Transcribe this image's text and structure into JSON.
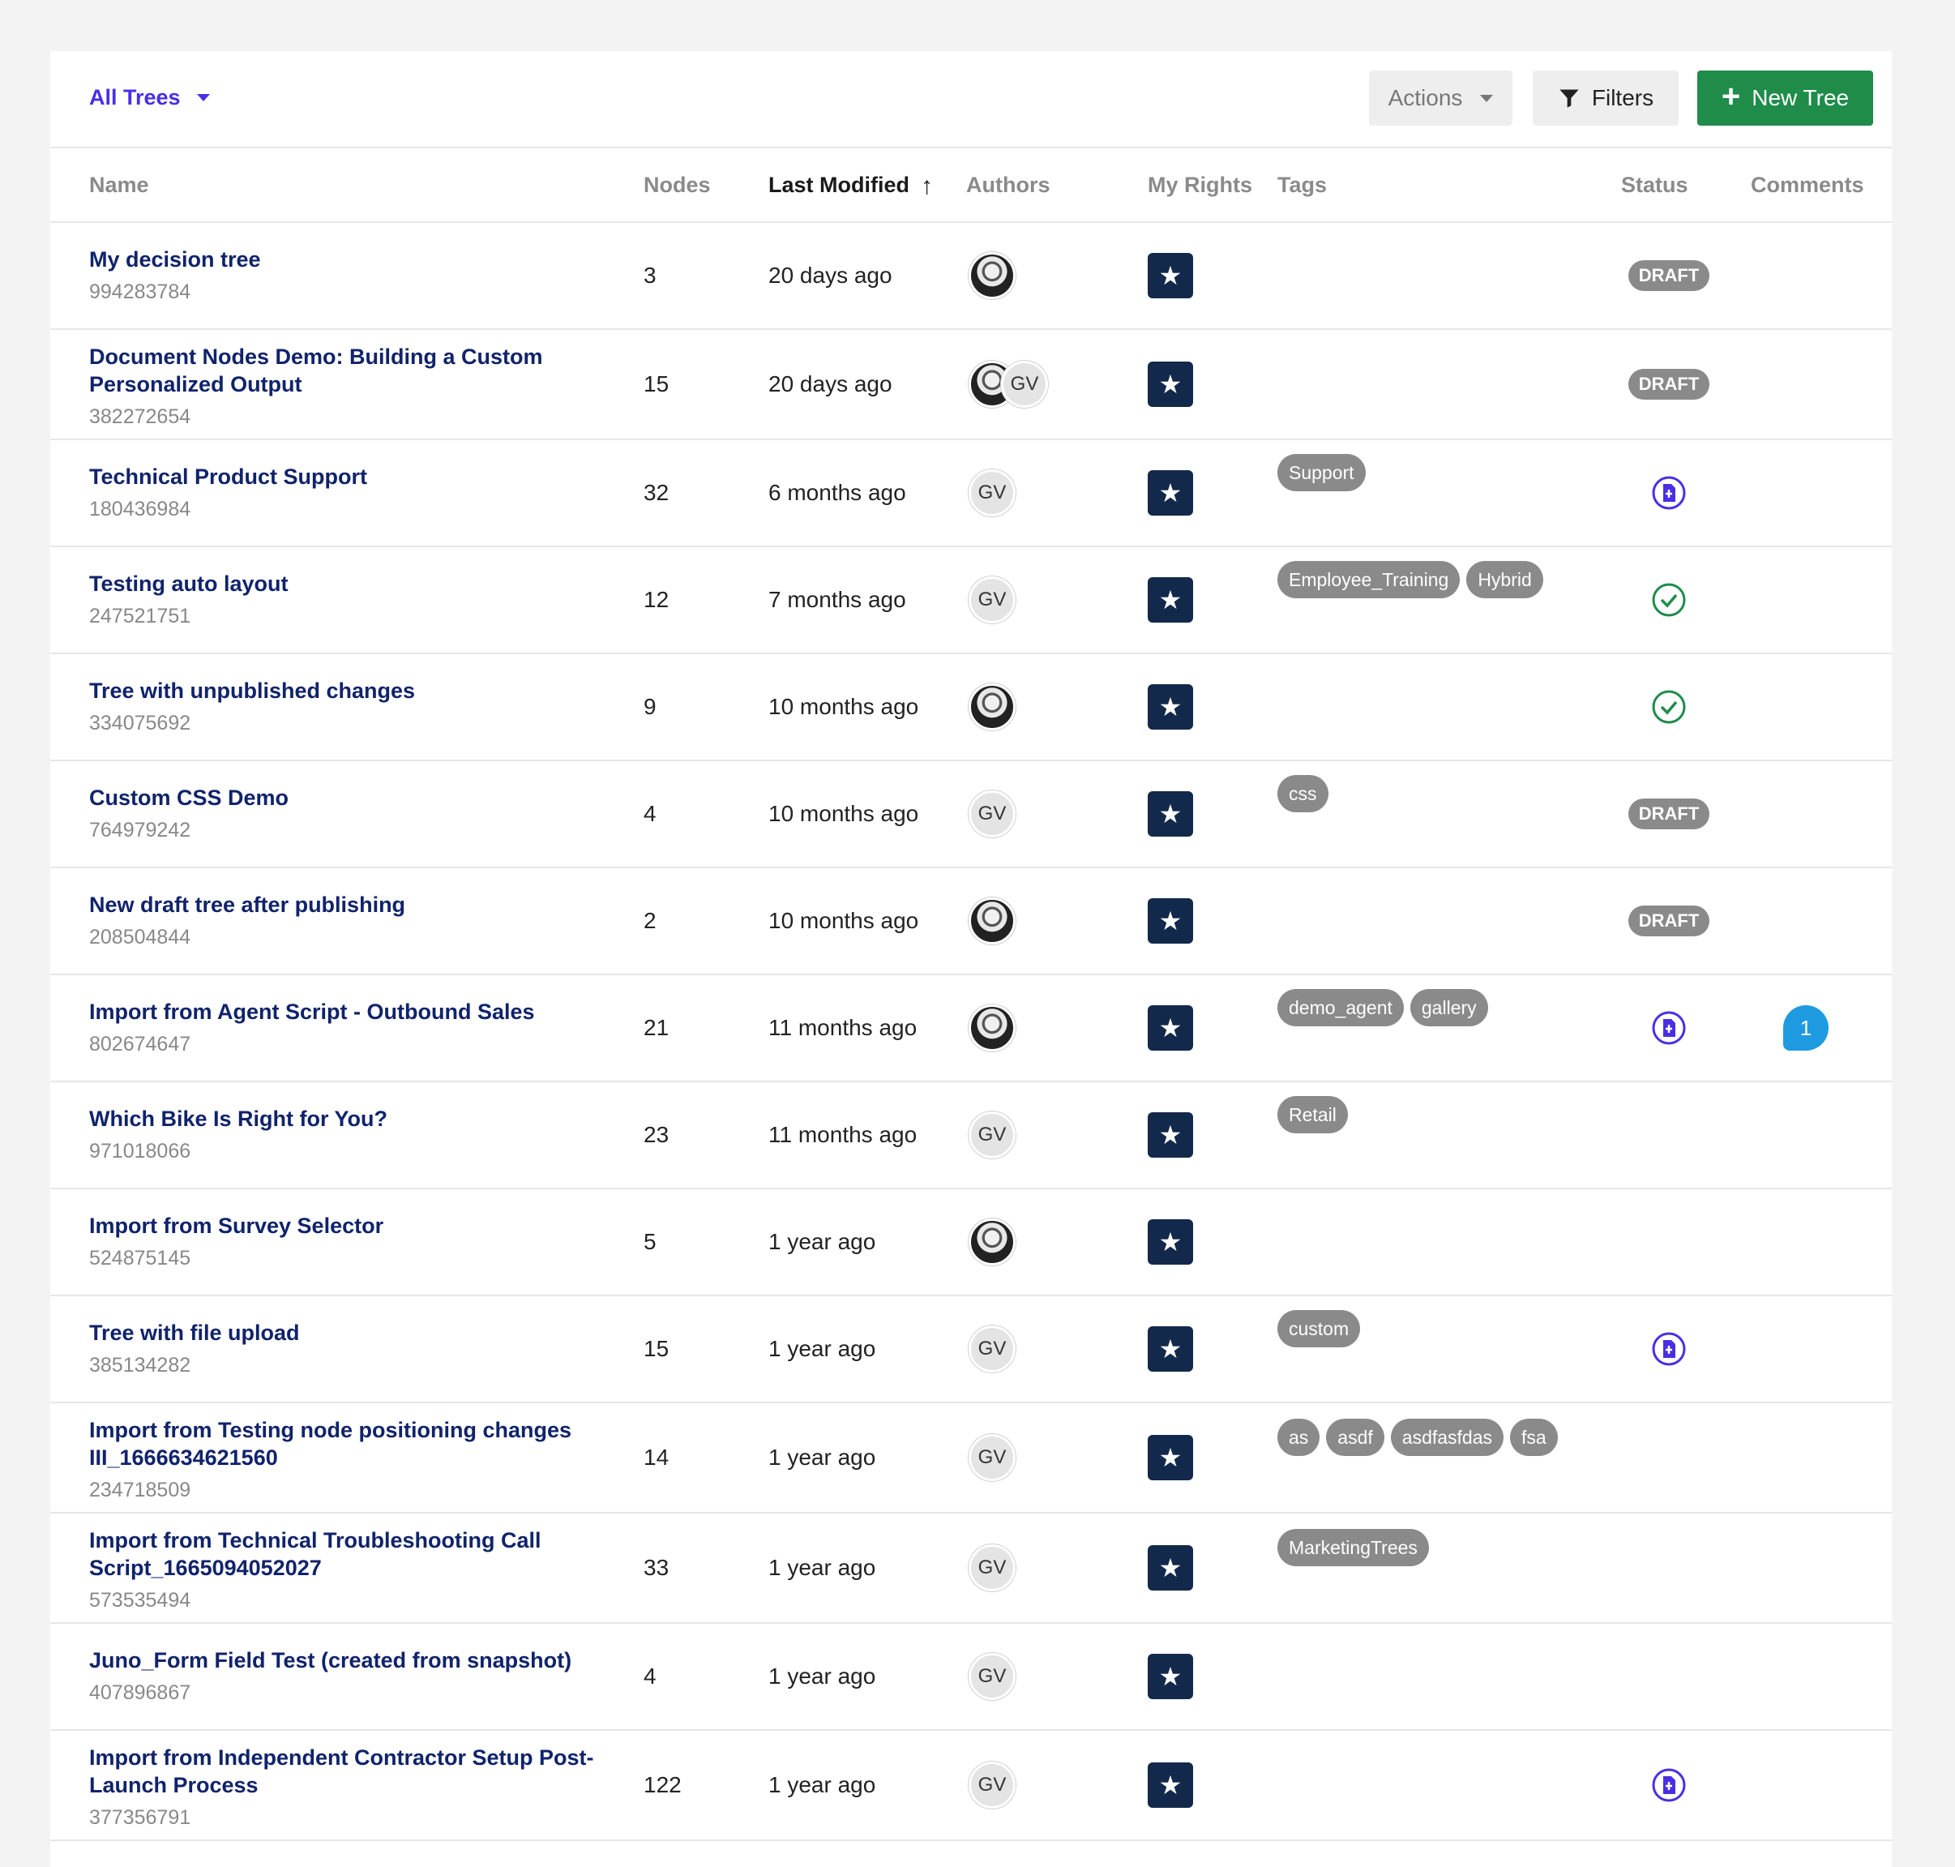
{
  "toolbar": {
    "all_trees_label": "All Trees",
    "actions_label": "Actions",
    "filters_label": "Filters",
    "new_tree_label": "New Tree"
  },
  "columns": {
    "name": "Name",
    "nodes": "Nodes",
    "last_modified": "Last Modified",
    "authors": "Authors",
    "my_rights": "My Rights",
    "tags": "Tags",
    "status": "Status",
    "comments": "Comments"
  },
  "colors": {
    "accent": "#4a2ee6",
    "primary_button": "#1f8c4a",
    "tree_name": "#10236b",
    "rights_badge": "#13294b",
    "tag": "#8a8a8a",
    "published_check": "#1f8c4a",
    "comment_badge": "#1e9be0"
  },
  "rows": [
    {
      "name": "My decision tree",
      "id": "994283784",
      "nodes": "3",
      "modified": "20 days ago",
      "authors": [
        "photo"
      ],
      "rights": "star-icon",
      "tags": [],
      "status": "DRAFT",
      "comments": ""
    },
    {
      "name": "Document Nodes Demo: Building a Custom Personalized Output",
      "id": "382272654",
      "nodes": "15",
      "modified": "20 days ago",
      "authors": [
        "photo",
        "GV"
      ],
      "rights": "star-icon",
      "tags": [],
      "status": "DRAFT",
      "comments": ""
    },
    {
      "name": "Technical Product Support",
      "id": "180436984",
      "nodes": "32",
      "modified": "6 months ago",
      "authors": [
        "GV"
      ],
      "rights": "star-icon",
      "tags": [
        "Support"
      ],
      "status": "unpublished-changes-icon",
      "comments": ""
    },
    {
      "name": "Testing auto layout",
      "id": "247521751",
      "nodes": "12",
      "modified": "7 months ago",
      "authors": [
        "GV"
      ],
      "rights": "star-icon",
      "tags": [
        "Employee_Training",
        "Hybrid"
      ],
      "status": "published-check-icon",
      "comments": ""
    },
    {
      "name": "Tree with unpublished changes",
      "id": "334075692",
      "nodes": "9",
      "modified": "10 months ago",
      "authors": [
        "photo"
      ],
      "rights": "star-icon",
      "tags": [],
      "status": "published-check-icon",
      "comments": ""
    },
    {
      "name": "Custom CSS Demo",
      "id": "764979242",
      "nodes": "4",
      "modified": "10 months ago",
      "authors": [
        "GV"
      ],
      "rights": "star-icon",
      "tags": [
        "css"
      ],
      "status": "DRAFT",
      "comments": ""
    },
    {
      "name": "New draft tree after publishing",
      "id": "208504844",
      "nodes": "2",
      "modified": "10 months ago",
      "authors": [
        "photo"
      ],
      "rights": "star-icon",
      "tags": [],
      "status": "DRAFT",
      "comments": ""
    },
    {
      "name": "Import from Agent Script - Outbound Sales",
      "id": "802674647",
      "nodes": "21",
      "modified": "11 months ago",
      "authors": [
        "photo"
      ],
      "rights": "star-icon",
      "tags": [
        "demo_agent",
        "gallery"
      ],
      "status": "unpublished-changes-icon",
      "comments": "1"
    },
    {
      "name": "Which Bike Is Right for You?",
      "id": "971018066",
      "nodes": "23",
      "modified": "11 months ago",
      "authors": [
        "GV"
      ],
      "rights": "star-icon",
      "tags": [
        "Retail"
      ],
      "status": "",
      "comments": ""
    },
    {
      "name": "Import from Survey Selector",
      "id": "524875145",
      "nodes": "5",
      "modified": "1 year ago",
      "authors": [
        "photo"
      ],
      "rights": "star-icon",
      "tags": [],
      "status": "",
      "comments": ""
    },
    {
      "name": "Tree with file upload",
      "id": "385134282",
      "nodes": "15",
      "modified": "1 year ago",
      "authors": [
        "GV"
      ],
      "rights": "star-icon",
      "tags": [
        "custom"
      ],
      "status": "unpublished-changes-icon",
      "comments": ""
    },
    {
      "name": "Import from Testing node positioning changes III_1666634621560",
      "id": "234718509",
      "nodes": "14",
      "modified": "1 year ago",
      "authors": [
        "GV"
      ],
      "rights": "star-icon",
      "tags": [
        "as",
        "asdf",
        "asdfasfdas",
        "fsa"
      ],
      "status": "",
      "comments": ""
    },
    {
      "name": "Import from Technical Troubleshooting Call Script_1665094052027",
      "id": "573535494",
      "nodes": "33",
      "modified": "1 year ago",
      "authors": [
        "GV"
      ],
      "rights": "star-icon",
      "tags": [
        "MarketingTrees"
      ],
      "status": "",
      "comments": ""
    },
    {
      "name": "Juno_Form Field Test (created from snapshot)",
      "id": "407896867",
      "nodes": "4",
      "modified": "1 year ago",
      "authors": [
        "GV"
      ],
      "rights": "star-icon",
      "tags": [],
      "status": "",
      "comments": ""
    },
    {
      "name": "Import from Independent Contractor Setup Post-Launch Process",
      "id": "377356791",
      "nodes": "122",
      "modified": "1 year ago",
      "authors": [
        "GV"
      ],
      "rights": "star-icon",
      "tags": [],
      "status": "unpublished-changes-icon",
      "comments": ""
    }
  ]
}
